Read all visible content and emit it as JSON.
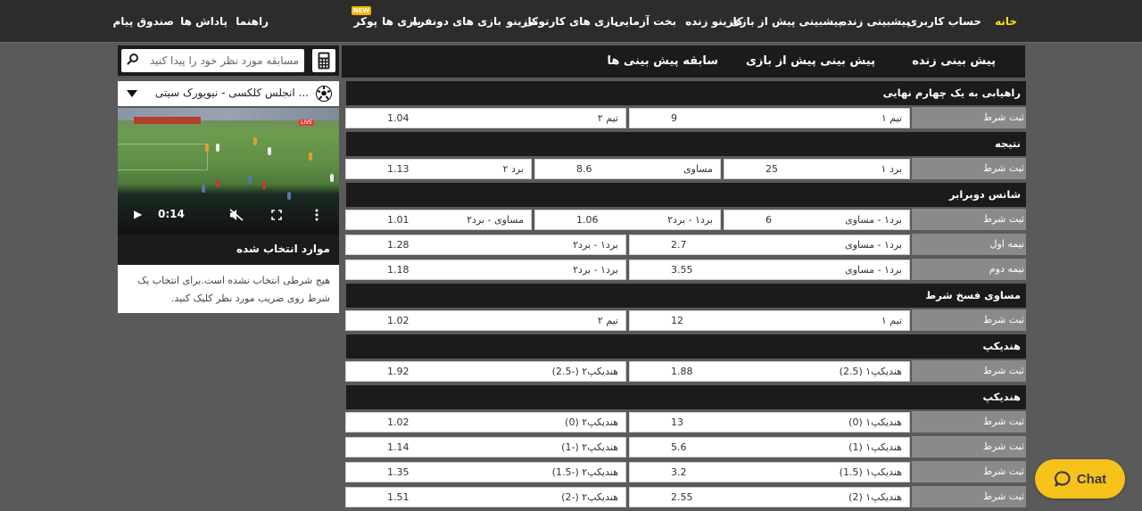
{
  "nav": {
    "items": [
      {
        "label": "خانه",
        "active": true
      },
      {
        "label": "حساب کاربری"
      },
      {
        "label": "پیشبینی زنده"
      },
      {
        "label": "پیشبینی پیش از بازی"
      },
      {
        "label": "کازینو زنده"
      },
      {
        "label": "بخت آزمایی"
      },
      {
        "label": "بازی های کارتونی"
      },
      {
        "label": "کازینو"
      },
      {
        "label": "بازی های دونفره"
      },
      {
        "label": "بازی ها"
      },
      {
        "label": "پوکر",
        "badge": "NEW"
      },
      {
        "label": "راهنما"
      },
      {
        "label": "پاداش ها"
      },
      {
        "label": "صندوق پیام"
      }
    ],
    "active_color": "#f2e600"
  },
  "sidebar": {
    "search_placeholder": "مسابقه مورد نظر خود را پیدا کنید",
    "match_select": "... انجلس کلکسی - نیویورک سیتی",
    "video": {
      "time": "0:14",
      "live_badge": "LIVE"
    },
    "selected": {
      "title": "موارد انتخاب شده",
      "empty_message": "هیج شرطی انتخاب نشده است.برای انتخاب یک شرط روی ضریب مورد نظر کلیک کنید."
    }
  },
  "main": {
    "tabs": [
      {
        "label": "پیش بینی زنده"
      },
      {
        "label": "پیش بینی پیش از بازی"
      },
      {
        "label": "سابقه پیش بینی ها"
      }
    ],
    "sections": [
      {
        "title": "راهیابی به یک چهارم نهایی",
        "rows": [
          {
            "label": "ثبت شرط",
            "odds": [
              {
                "name": "تیم ۱",
                "value": "9"
              },
              {
                "name": "تیم ۲",
                "value": "1.04"
              }
            ]
          }
        ]
      },
      {
        "title": "نتیجه",
        "rows": [
          {
            "label": "ثبت شرط",
            "odds": [
              {
                "name": "برد ۱",
                "value": "25"
              },
              {
                "name": "مساوی",
                "value": "8.6"
              },
              {
                "name": "برد ۲",
                "value": "1.13"
              }
            ]
          }
        ]
      },
      {
        "title": "شانس دوبرابر",
        "rows": [
          {
            "label": "ثبت شرط",
            "odds": [
              {
                "name": "برد۱ - مساوی",
                "value": "6"
              },
              {
                "name": "برد۱ - برد۲",
                "value": "1.06"
              },
              {
                "name": "مساوی - برد۲",
                "value": "1.01"
              }
            ]
          },
          {
            "label": "نیمه اول",
            "odds": [
              {
                "name": "برد۱ - مساوی",
                "value": "2.7"
              },
              {
                "name": "برد۱ - برد۲",
                "value": "1.28"
              }
            ]
          },
          {
            "label": "نیمه دوم",
            "odds": [
              {
                "name": "برد۱ - مساوی",
                "value": "3.55"
              },
              {
                "name": "برد۱ - برد۲",
                "value": "1.18"
              }
            ]
          }
        ]
      },
      {
        "title": "مساوی فسخ شرط",
        "rows": [
          {
            "label": "ثبت شرط",
            "odds": [
              {
                "name": "تیم ۱",
                "value": "12"
              },
              {
                "name": "تیم ۲",
                "value": "1.02"
              }
            ]
          }
        ]
      },
      {
        "title": "هندیکپ",
        "rows": [
          {
            "label": "ثبت شرط",
            "odds": [
              {
                "name": "هندیکپ۱ (2.5)",
                "value": "1.88"
              },
              {
                "name": "هندیکپ۲ (-2.5)",
                "value": "1.92"
              }
            ]
          }
        ]
      },
      {
        "title": "هندیکپ",
        "rows": [
          {
            "label": "ثبت شرط",
            "odds": [
              {
                "name": "هندیکپ۱ (0)",
                "value": "13"
              },
              {
                "name": "هندیکپ۲ (0)",
                "value": "1.02"
              }
            ]
          },
          {
            "label": "ثبت شرط",
            "odds": [
              {
                "name": "هندیکپ۱ (1)",
                "value": "5.6"
              },
              {
                "name": "هندیکپ۲ (-1)",
                "value": "1.14"
              }
            ]
          },
          {
            "label": "ثبت شرط",
            "odds": [
              {
                "name": "هندیکپ۱ (1.5)",
                "value": "3.2"
              },
              {
                "name": "هندیکپ۲ (-1.5)",
                "value": "1.35"
              }
            ]
          },
          {
            "label": "ثبت شرط",
            "odds": [
              {
                "name": "هندیکپ۱ (2)",
                "value": "2.55"
              },
              {
                "name": "هندیکپ۲ (-2)",
                "value": "1.51"
              }
            ]
          }
        ]
      }
    ]
  },
  "chat": {
    "label": "Chat",
    "color": "#f7c21c"
  }
}
